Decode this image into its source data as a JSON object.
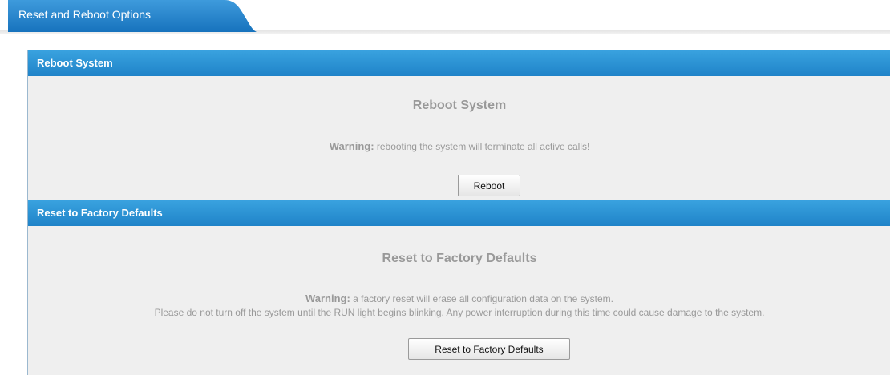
{
  "tab": {
    "label": "Reset and Reboot Options"
  },
  "reboot": {
    "header": "Reboot System",
    "title": "Reboot System",
    "warning_label": "Warning:",
    "warning_text": " rebooting the system will terminate all active calls!",
    "button_label": "Reboot"
  },
  "reset": {
    "header": "Reset to Factory Defaults",
    "title": "Reset to Factory Defaults",
    "warning_label": "Warning:",
    "warning_text": " a factory reset will erase all configuration data on the system.",
    "warning_line2": "Please do not turn off the system until the RUN light begins blinking. Any power interruption during this time could cause damage to the system.",
    "button_label": "Reset to Factory Defaults"
  },
  "colors": {
    "header_blue": "#1f83c8",
    "tab_blue": "#1f7fc4",
    "panel_bg": "#efefef",
    "muted_text": "#999999"
  }
}
